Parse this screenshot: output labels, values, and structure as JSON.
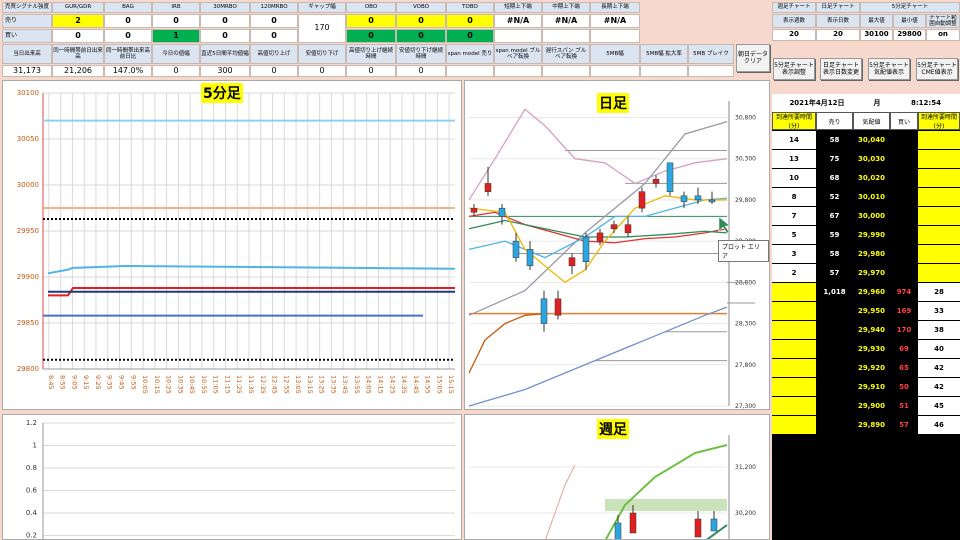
{
  "top_headers": [
    "売買シグナル強度",
    "GUR/GDR",
    "BAG",
    "IRB",
    "30MRBO",
    "120MRBO",
    "ギャップ幅",
    "OBO",
    "VOBO",
    "TOBO",
    "短期上下端",
    "中期上下端",
    "長期上下端"
  ],
  "row_sell_label": "売り",
  "row_buy_label": "買い",
  "sell_values": [
    "2",
    "0",
    "0",
    "0",
    "0",
    "",
    "0",
    "0",
    "0",
    "#N/A",
    "#N/A",
    "#N/A"
  ],
  "buy_values": [
    "0",
    "0",
    "1",
    "0",
    "0",
    "",
    "0",
    "0",
    "0",
    "",
    "",
    ""
  ],
  "gap_value": "170",
  "second_headers": [
    "当日出来高",
    "同一時間帯前日出来高",
    "同一時間帯出来高前日比",
    "今日の値幅",
    "直近5日間平均値幅",
    "高値切り上げ",
    "安値切り下げ",
    "高値切り上げ継続時間",
    "安値切り下げ継続時間",
    "span model 売り",
    "span model ブルベア転換",
    "遅行スパン ブルベア転換",
    "5MB幅",
    "5MB幅 拡大率",
    "5MB ブレイク"
  ],
  "second_values": [
    "31,173",
    "21,206",
    "147.0%",
    "0",
    "300",
    "0",
    "0",
    "0",
    "0",
    "",
    "",
    "",
    "",
    "",
    ""
  ],
  "buttons": {
    "clear": "朝日データクリア",
    "five_adjust": "5分足チャート表示調整",
    "daily_change": "日足チャート表示日数変更",
    "five_display": "5分足チャート気配値表示",
    "cme": "5分足チャートCME値表示"
  },
  "right_top": {
    "weekly_chart": "週足チャート",
    "daily_chart": "日足チャート",
    "five_chart": "5分足チャート",
    "headers": [
      "表示週数",
      "表示日数",
      "最大値",
      "最小値",
      "チャート範囲自動調整"
    ],
    "values": [
      "20",
      "20",
      "30100",
      "29800",
      "on"
    ]
  },
  "board": {
    "date": "2021年4月12日",
    "weekday": "月",
    "time": "8:12:54",
    "col_headers": [
      "到達所要時間(分)",
      "売り",
      "気配値",
      "買い",
      "到達所要時間(分)"
    ],
    "sell_rows": [
      {
        "t": "14",
        "q": "58",
        "p": "30,040"
      },
      {
        "t": "13",
        "q": "75",
        "p": "30,030"
      },
      {
        "t": "10",
        "q": "68",
        "p": "30,020"
      },
      {
        "t": "8",
        "q": "52",
        "p": "30,010"
      },
      {
        "t": "7",
        "q": "67",
        "p": "30,000"
      },
      {
        "t": "5",
        "q": "59",
        "p": "29,990"
      },
      {
        "t": "3",
        "q": "58",
        "p": "29,980"
      },
      {
        "t": "2",
        "q": "57",
        "p": "29,970"
      }
    ],
    "mid_row": {
      "q": "1,018",
      "p": "29,960",
      "b": "974",
      "t": "28"
    },
    "buy_rows": [
      {
        "p": "29,950",
        "b": "169",
        "t": "33"
      },
      {
        "p": "29,940",
        "b": "170",
        "t": "38"
      },
      {
        "p": "29,930",
        "b": "69",
        "t": "40"
      },
      {
        "p": "29,920",
        "b": "65",
        "t": "42"
      },
      {
        "p": "29,910",
        "b": "50",
        "t": "42"
      },
      {
        "p": "29,900",
        "b": "51",
        "t": "45"
      },
      {
        "p": "29,890",
        "b": "57",
        "t": "46"
      }
    ]
  },
  "charts": {
    "five_title": "5分足",
    "daily_title": "日足",
    "weekly_title": "週足",
    "plot_area_label": "プロット エリア"
  },
  "chart_data": [
    {
      "type": "line",
      "title": "5分足",
      "ylim": [
        29800,
        30100
      ],
      "y_ticks": [
        "30100",
        "30050",
        "30000",
        "29950",
        "29900",
        "29850",
        "29800"
      ],
      "x_ticks": [
        "8:45",
        "8:55",
        "9:05",
        "9:15",
        "9:25",
        "9:35",
        "9:45",
        "9:55",
        "10:05",
        "10:15",
        "10:25",
        "10:35",
        "10:45",
        "10:55",
        "11:05",
        "11:15",
        "11:25",
        "11:35",
        "12:35",
        "12:45",
        "12:55",
        "13:05",
        "13:15",
        "13:25",
        "13:35",
        "13:45",
        "13:55",
        "14:05",
        "14:15",
        "14:25",
        "14:35",
        "14:45",
        "14:55",
        "15:05",
        "15:15"
      ],
      "series": [
        {
          "color": "#4fb3e8",
          "values": [
            29904,
            29908,
            29910,
            29910,
            29912,
            29909
          ]
        },
        {
          "color": "#e02020",
          "values": [
            29880,
            29880,
            29888,
            29888,
            29888,
            29888
          ]
        },
        {
          "color": "#1f3a7a",
          "values": [
            29884,
            29884,
            29884,
            29884,
            29884,
            29884
          ]
        }
      ],
      "levels": [
        {
          "color": "#8fd0f0",
          "value": 30070
        },
        {
          "color": "#f4b183",
          "value": 29975
        },
        {
          "color": "#000000",
          "value": 29963
        },
        {
          "color": "#4472c4",
          "value": 29858
        },
        {
          "color": "#000000",
          "value": 29810
        }
      ]
    },
    {
      "type": "candlestick",
      "title": "日足",
      "ylim": [
        27300,
        31000
      ],
      "y_ticks": [
        "30,800",
        "30,300",
        "29,800",
        "29,300",
        "28,800",
        "28,300",
        "27,800",
        "27,300"
      ]
    },
    {
      "type": "candlestick",
      "title": "週足",
      "y_ticks": [
        "31,200",
        "30,200"
      ]
    },
    {
      "type": "line",
      "y_ticks": [
        "1.2",
        "1",
        "0.8",
        "0.6",
        "0.4",
        "0.2"
      ]
    }
  ]
}
